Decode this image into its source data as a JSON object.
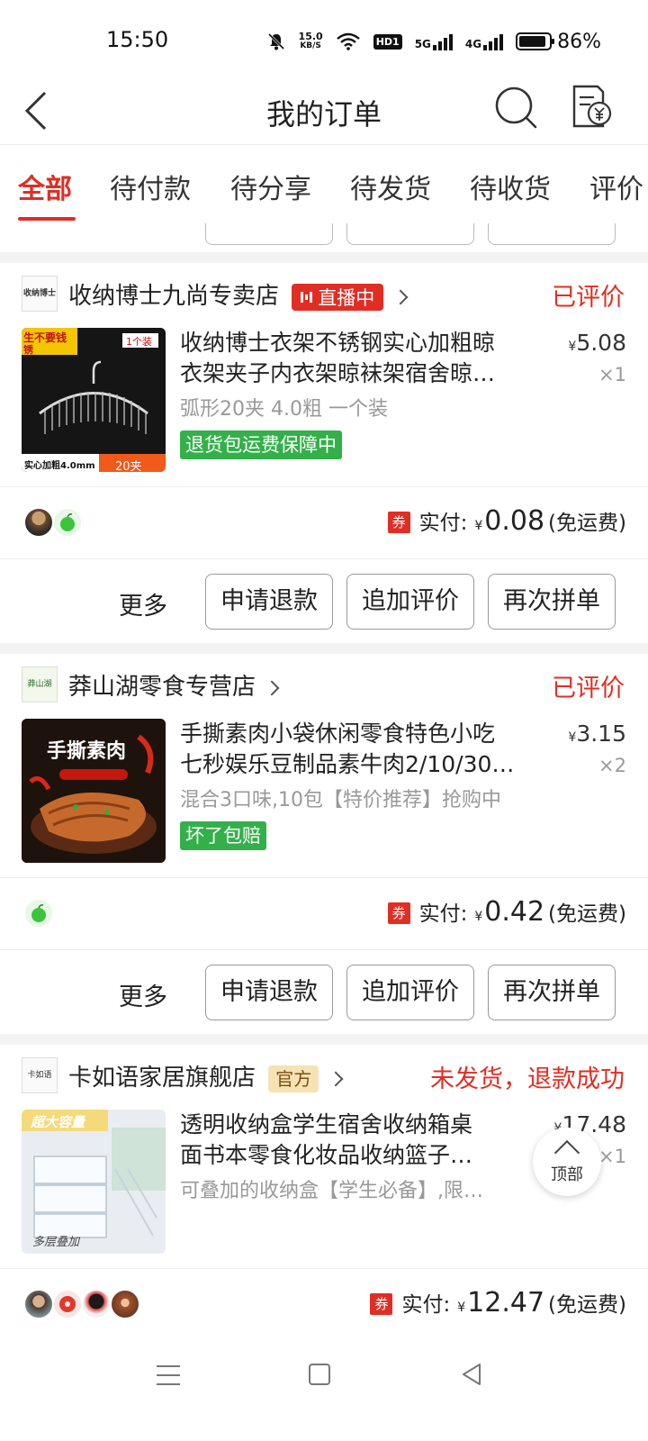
{
  "status_bar": {
    "time": "15:50",
    "net_speed_value": "15.0",
    "net_speed_unit": "KB/S",
    "hd_label": "HD1",
    "net1": "5G",
    "net2": "4G",
    "battery": "86%"
  },
  "nav": {
    "title": "我的订单",
    "back_icon": "back-arrow-icon",
    "search_icon": "search-icon",
    "bill_icon": "bill-icon"
  },
  "tabs": [
    {
      "label": "全部",
      "active": true
    },
    {
      "label": "待付款"
    },
    {
      "label": "待分享"
    },
    {
      "label": "待发货"
    },
    {
      "label": "待收货"
    },
    {
      "label": "评价"
    }
  ],
  "orders": [
    {
      "shop": {
        "logo_text": "收纳博士",
        "name": "收纳博士九尚专卖店",
        "badge": "直播中"
      },
      "status": "已评价",
      "product": {
        "title_line1": "收纳博士衣架不锈钢实心加粗晾",
        "title_line2": "衣架夹子内衣架晾袜架宿舍晾…",
        "spec": "弧形20夹 4.0粗 一个装",
        "tag": "退货包运费保障中",
        "price": "5.08",
        "qty": "×1",
        "image_texts": {
          "corner1": "生不要钱",
          "corner2": "锈",
          "pack": "1个装",
          "bottom_left": "实心加粗4.0mm",
          "bottom_right": "20夹"
        }
      },
      "payment": {
        "coupon": "券",
        "label": "实付:",
        "amount": "0.08",
        "shipping": "(免运费)"
      },
      "actions": {
        "more": "更多",
        "btn1": "申请退款",
        "btn2": "追加评价",
        "btn3": "再次拼单"
      }
    },
    {
      "shop": {
        "logo_text": "莽山湖",
        "name": "莽山湖零食专营店"
      },
      "status": "已评价",
      "product": {
        "title_line1": "手撕素肉小袋休闲零食特色小吃",
        "title_line2": "七秒娱乐豆制品素牛肉2/10/30…",
        "spec": "混合3口味,10包【特价推荐】抢购中",
        "tag": "坏了包赔",
        "price": "3.15",
        "qty": "×2",
        "image_texts": {
          "headline": "手撕素肉"
        }
      },
      "payment": {
        "coupon": "券",
        "label": "实付:",
        "amount": "0.42",
        "shipping": "(免运费)"
      },
      "actions": {
        "more": "更多",
        "btn1": "申请退款",
        "btn2": "追加评价",
        "btn3": "再次拼单"
      }
    },
    {
      "shop": {
        "logo_text": "卡如语",
        "name": "卡如语家居旗舰店",
        "badge": "官方"
      },
      "status": "未发货，退款成功",
      "product": {
        "title_line1": "透明收纳盒学生宿舍收纳箱桌",
        "title_line2": "面书本零食化妆品收纳篮子…",
        "spec": "可叠加的收纳盒【学生必备】,限…",
        "price": "17.48",
        "qty": "×1",
        "image_texts": {
          "top": "超大容量",
          "bottom": "多层叠加"
        }
      },
      "payment": {
        "coupon": "券",
        "label": "实付:",
        "amount": "12.47",
        "shipping": "(免运费)"
      }
    }
  ],
  "floating": {
    "top_button": "顶部"
  },
  "currency_symbol": "¥",
  "colors": {
    "accent": "#e02e24",
    "tag_green": "#34b04a",
    "official_bg": "#f7e2b5"
  }
}
